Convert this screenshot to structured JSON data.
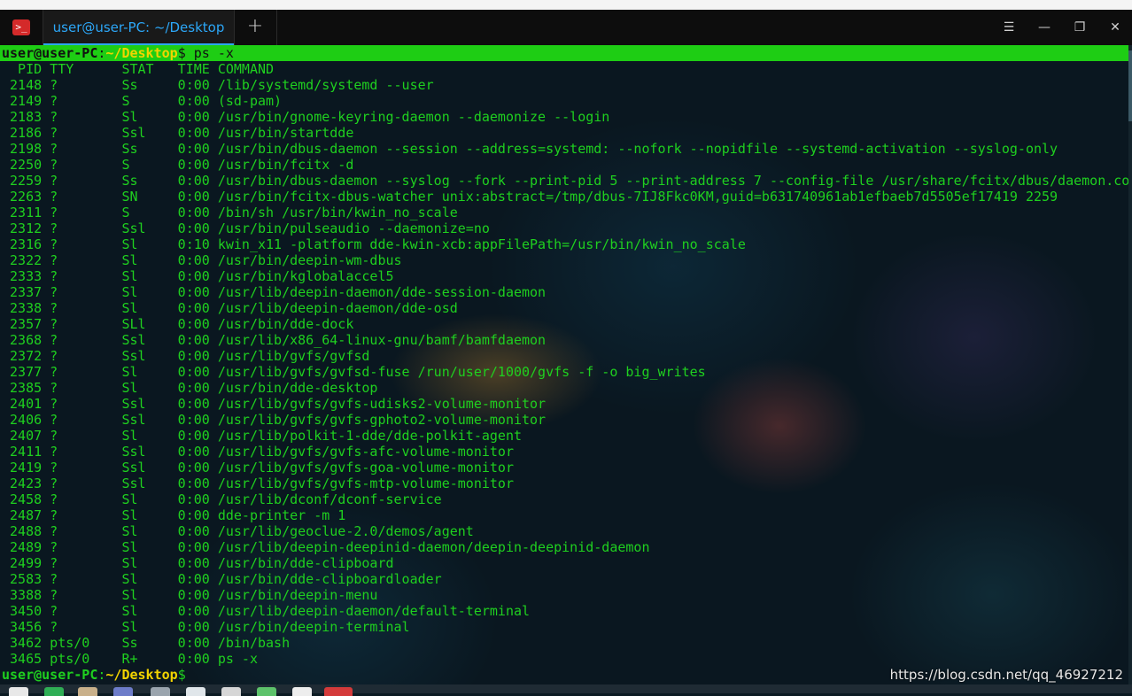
{
  "window": {
    "tab_title": "user@user-PC: ~/Desktop",
    "add_tab_label": "+",
    "controls": {
      "menu": "☰",
      "minimize": "—",
      "maximize": "❐",
      "close": "✕"
    }
  },
  "terminal": {
    "prompt": {
      "user": "user@user-PC",
      "sep": ":",
      "path": "~/Desktop",
      "dollar": "$",
      "command": " ps -x"
    },
    "header": "  PID TTY      STAT   TIME COMMAND",
    "lines": [
      " 2148 ?        Ss     0:00 /lib/systemd/systemd --user",
      " 2149 ?        S      0:00 (sd-pam)",
      " 2183 ?        Sl     0:00 /usr/bin/gnome-keyring-daemon --daemonize --login",
      " 2186 ?        Ssl    0:00 /usr/bin/startdde",
      " 2198 ?        Ss     0:00 /usr/bin/dbus-daemon --session --address=systemd: --nofork --nopidfile --systemd-activation --syslog-only",
      " 2250 ?        S      0:00 /usr/bin/fcitx -d",
      " 2259 ?        Ss     0:00 /usr/bin/dbus-daemon --syslog --fork --print-pid 5 --print-address 7 --config-file /usr/share/fcitx/dbus/daemon.con",
      " 2263 ?        SN     0:00 /usr/bin/fcitx-dbus-watcher unix:abstract=/tmp/dbus-7IJ8Fkc0KM,guid=b631740961ab1efbaeb7d5505ef17419 2259",
      " 2311 ?        S      0:00 /bin/sh /usr/bin/kwin_no_scale",
      " 2312 ?        Ssl    0:00 /usr/bin/pulseaudio --daemonize=no",
      " 2316 ?        Sl     0:10 kwin_x11 -platform dde-kwin-xcb:appFilePath=/usr/bin/kwin_no_scale",
      " 2322 ?        Sl     0:00 /usr/bin/deepin-wm-dbus",
      " 2333 ?        Sl     0:00 /usr/bin/kglobalaccel5",
      " 2337 ?        Sl     0:00 /usr/lib/deepin-daemon/dde-session-daemon",
      " 2338 ?        Sl     0:00 /usr/lib/deepin-daemon/dde-osd",
      " 2357 ?        SLl    0:00 /usr/bin/dde-dock",
      " 2368 ?        Ssl    0:00 /usr/lib/x86_64-linux-gnu/bamf/bamfdaemon",
      " 2372 ?        Ssl    0:00 /usr/lib/gvfs/gvfsd",
      " 2377 ?        Sl     0:00 /usr/lib/gvfs/gvfsd-fuse /run/user/1000/gvfs -f -o big_writes",
      " 2385 ?        Sl     0:00 /usr/bin/dde-desktop",
      " 2401 ?        Ssl    0:00 /usr/lib/gvfs/gvfs-udisks2-volume-monitor",
      " 2406 ?        Ssl    0:00 /usr/lib/gvfs/gvfs-gphoto2-volume-monitor",
      " 2407 ?        Sl     0:00 /usr/lib/polkit-1-dde/dde-polkit-agent",
      " 2411 ?        Ssl    0:00 /usr/lib/gvfs/gvfs-afc-volume-monitor",
      " 2419 ?        Ssl    0:00 /usr/lib/gvfs/gvfs-goa-volume-monitor",
      " 2423 ?        Ssl    0:00 /usr/lib/gvfs/gvfs-mtp-volume-monitor",
      " 2458 ?        Sl     0:00 /usr/lib/dconf/dconf-service",
      " 2487 ?        Sl     0:00 dde-printer -m 1",
      " 2488 ?        Sl     0:00 /usr/lib/geoclue-2.0/demos/agent",
      " 2489 ?        Sl     0:00 /usr/lib/deepin-deepinid-daemon/deepin-deepinid-daemon",
      " 2499 ?        Sl     0:00 /usr/bin/dde-clipboard",
      " 2583 ?        Sl     0:00 /usr/bin/dde-clipboardloader",
      " 3388 ?        Sl     0:00 /usr/bin/deepin-menu",
      " 3450 ?        Sl     0:00 /usr/lib/deepin-daemon/default-terminal",
      " 3456 ?        Sl     0:00 /usr/bin/deepin-terminal",
      " 3462 pts/0    Ss     0:00 /bin/bash",
      " 3465 pts/0    R+     0:00 ps -x"
    ],
    "final_prompt": {
      "user": "user@user-PC",
      "sep": ":",
      "path": "~/Desktop",
      "dollar": "$"
    }
  },
  "watermark": "https://blog.csdn.net/qq_46927212",
  "colors": {
    "accent": "#2ca7f8",
    "prompt_bar": "#1ecd14",
    "text": "#1fd01f",
    "path": "#f2d400"
  }
}
